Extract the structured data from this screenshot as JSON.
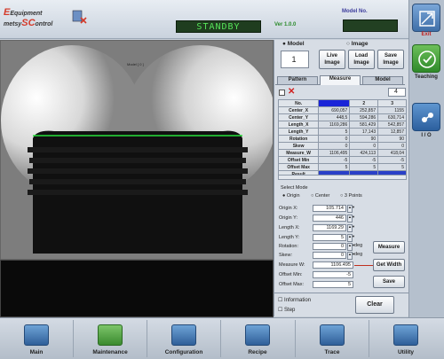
{
  "header": {
    "logo_line1": "Equipment",
    "logo_line2_pre": "metsy",
    "logo_line2_accent": "SC",
    "logo_line2_post": "ontrol",
    "logo_accent_e": "E",
    "status": "STANDBY",
    "version": "Ver 1.0.0",
    "model_no_label": "Model No."
  },
  "right_nav": {
    "exit": "Exit",
    "teaching": "Teaching",
    "io": "I / O"
  },
  "image_view": {
    "overlay_text": "Model [ 0 ]"
  },
  "panel": {
    "model_radio": "Model",
    "image_radio": "Image",
    "model_value": "1",
    "live_image": "Live Image",
    "load_image": "Load Image",
    "save_image": "Save Image",
    "tabs": [
      "Pattern",
      "Measure",
      "Model"
    ],
    "count": "4",
    "table": {
      "headers": [
        "No.",
        "1",
        "2",
        "3"
      ],
      "rows": [
        [
          "Center_X",
          "690,057",
          "252,857",
          "1155"
        ],
        [
          "Center_Y",
          "448,5",
          "594,286",
          "630,714"
        ],
        [
          "Length_X",
          "1169,286",
          "581,429",
          "542,857"
        ],
        [
          "Length_Y",
          "5",
          "17,143",
          "12,857"
        ],
        [
          "Rotation",
          "0",
          "90",
          "90"
        ],
        [
          "Skew",
          "0",
          "0",
          "0"
        ],
        [
          "Measure_W",
          "1106,495",
          "424,113",
          "418,04"
        ],
        [
          "Offset Min",
          "-5",
          "-5",
          "-5"
        ],
        [
          "Offset Max",
          "5",
          "5",
          "5"
        ],
        [
          "Result",
          "",
          "",
          ""
        ]
      ]
    },
    "select_mode_label": "Select Mode",
    "modes": [
      "Origin",
      "Center",
      "3 Points"
    ],
    "fields": [
      {
        "label": "Origin X:",
        "value": "105.714"
      },
      {
        "label": "Origin Y:",
        "value": "446"
      },
      {
        "label": "Length X:",
        "value": "1169.29"
      },
      {
        "label": "Length Y:",
        "value": "5"
      },
      {
        "label": "Rotation:",
        "value": "0"
      },
      {
        "label": "Skew:",
        "value": "0"
      }
    ],
    "deg1": "deg",
    "deg2": "deg",
    "measure_btn": "Measure",
    "measure_w_label": "Measure W:",
    "measure_w_value": "1106.495",
    "get_width_btn": "Get Width",
    "offset_min_label": "Offset Min:",
    "offset_min_value": "-5",
    "offset_max_label": "Offset Max:",
    "offset_max_value": "5",
    "save_btn": "Save",
    "information_cb": "Information",
    "step_cb": "Step",
    "clear_btn": "Clear"
  },
  "bottom_nav": [
    "Main",
    "Maintenance",
    "Configuration",
    "Recipe",
    "Trace",
    "Utility"
  ],
  "colors": {
    "accent": "#d43a2a",
    "status_green": "#56e45a",
    "selected_cell": "#1a24d8"
  }
}
